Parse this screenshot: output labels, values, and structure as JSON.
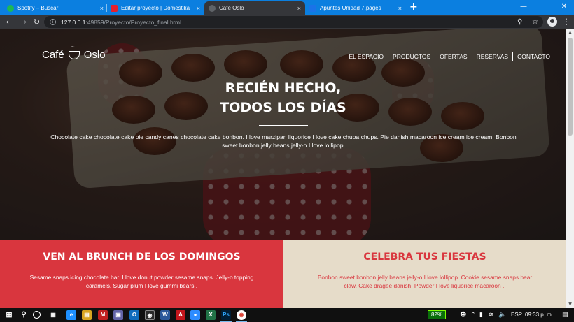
{
  "browser": {
    "tabs": [
      {
        "title": "Spotify – Buscar",
        "fav_color": "#1db954"
      },
      {
        "title": "Editar proyecto | Domestika",
        "fav_color": "#e4202e"
      },
      {
        "title": "Café Oslo",
        "fav_color": "#5f6368"
      },
      {
        "title": "Apuntes Unidad 7.pages",
        "fav_color": "#1a73e8"
      }
    ],
    "tab_close": "×",
    "new_tab": "+",
    "url_host": "127.0.0.1",
    "url_rest": ":49859/Proyecto/Proyecto_final.html"
  },
  "site": {
    "logo_left": "Café",
    "logo_right": "Oslo",
    "nav": [
      "EL ESPACIO",
      "PRODUCTOS",
      "OFERTAS",
      "RESERVAS",
      "CONTACTO"
    ],
    "hero_title_1": "RECIÉN HECHO,",
    "hero_title_2": "TODOS LOS DÍAS",
    "hero_text": "Chocolate cake chocolate cake pie candy canes chocolate cake bonbon. I love marzipan liquorice I love cake chupa chups. Pie danish macaroon ice cream ice cream. Bonbon sweet bonbon jelly beans jelly-o I love lollipop.",
    "promo_left": {
      "title": "VEN AL BRUNCH DE LOS DOMINGOS",
      "text": "Sesame snaps icing chocolate bar. I love donut powder sesame snaps. Jelly-o topping caramels. Sugar plum I love gummi bears ."
    },
    "promo_right": {
      "title": "CELEBRA TUS FIESTAS",
      "text": "Bonbon sweet bonbon jelly beans jelly-o I love lollipop. Cookie sesame snaps bear claw. Cake dragée danish. Powder I love liquorice macaroon .."
    },
    "colors": {
      "accent_red": "#d9363e",
      "cream": "#e6dcc9"
    }
  },
  "taskbar": {
    "battery": "82%",
    "language": "ESP",
    "clock": "09:33 p. m."
  }
}
